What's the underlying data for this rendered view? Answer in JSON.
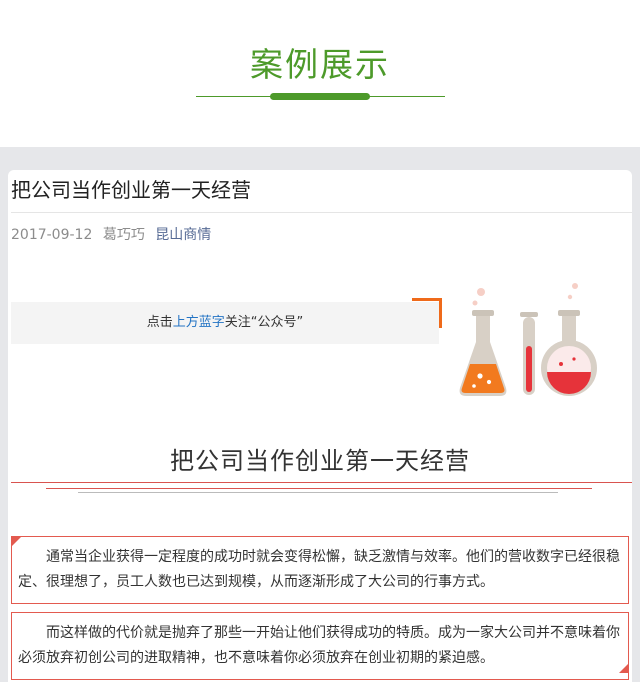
{
  "section": {
    "title": "案例展示"
  },
  "article": {
    "title": "把公司当作创业第一天经营",
    "date": "2017-09-12",
    "author": "葛巧巧",
    "source": "昆山商情",
    "follow": {
      "pre": "点击",
      "link": "上方蓝字",
      "post": "关注“公众号”"
    },
    "subtitle": "把公司当作创业第一天经营",
    "paragraphs": [
      "通常当企业获得一定程度的成功时就会变得松懈，缺乏激情与效率。他们的营收数字已经很稳定、很理想了，员工人数也已达到规模，从而逐渐形成了大公司的行事方式。",
      "而这样做的代价就是抛弃了那些一开始让他们获得成功的特质。成为一家大公司并不意味着你必须放弃初创公司的进取精神，也不意味着你必须放弃在创业初期的紧迫感。"
    ]
  },
  "colors": {
    "brand_green": "#4d9a2a",
    "accent_red": "#e35a4f",
    "accent_orange": "#ef6a1a",
    "link_blue": "#576b95",
    "band_gray": "#e6e7ea"
  },
  "icons": [
    "erlenmeyer-flask-icon",
    "test-tube-icon",
    "round-flask-icon"
  ]
}
